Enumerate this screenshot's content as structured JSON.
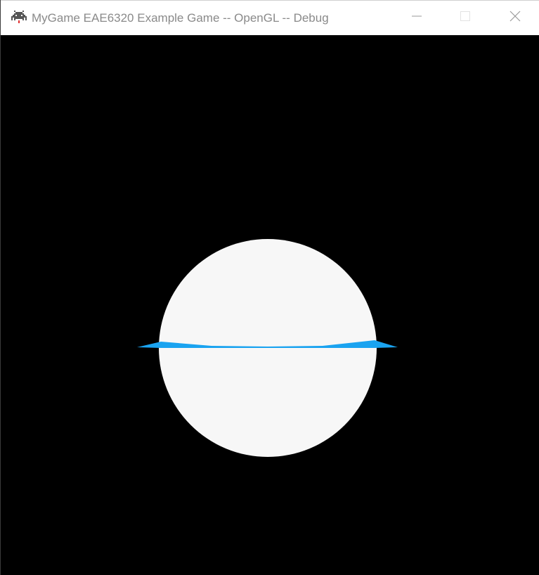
{
  "window": {
    "title": "MyGame EAE6320 Example Game -- OpenGL -- Debug",
    "app_icon": "space-invader-icon",
    "controls": {
      "minimize_icon": "minimize-icon",
      "maximize_icon": "maximize-icon",
      "close_icon": "close-icon"
    }
  },
  "scene": {
    "background_color": "#000000",
    "sphere_color": "#f7f7f7",
    "plane_color": "#1aa3f0"
  }
}
